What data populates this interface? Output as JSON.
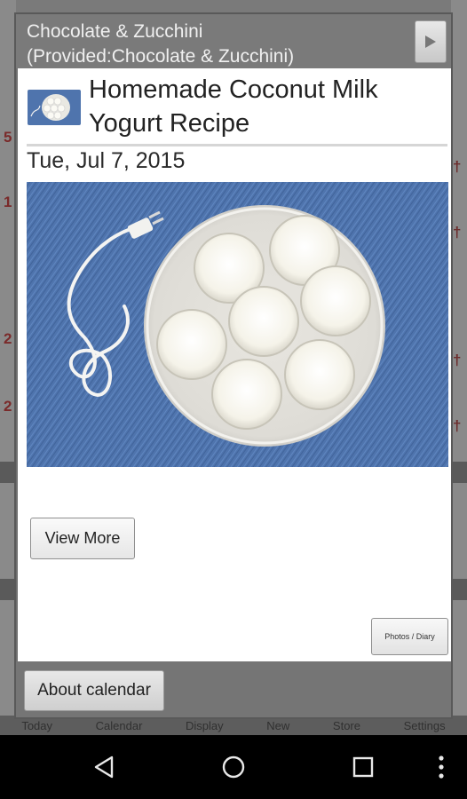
{
  "dialog": {
    "title": "Chocolate & Zucchini\n(Provided:Chocolate & Zucchini)",
    "next_icon": "play-triangle-icon"
  },
  "post": {
    "title": "Homemade Coconut Milk Yogurt Recipe",
    "date": "Tue, Jul 7, 2015",
    "thumbnail_icon": "yogurt-thumbnail",
    "photo_icon": "yogurt-jars-photo"
  },
  "buttons": {
    "view_more": "View More",
    "photos_diary": "Photos / Diary",
    "about_calendar": "About calendar"
  },
  "background_app": {
    "bottom_tabs": [
      "Today",
      "Calendar",
      "Display",
      "New",
      "Store",
      "Settings"
    ]
  },
  "nav": {
    "back_icon": "back-triangle-icon",
    "home_icon": "home-circle-icon",
    "recents_icon": "recents-square-icon",
    "menu_icon": "overflow-menu-icon"
  },
  "colors": {
    "denim_blue": "#4f74ad",
    "dialog_gray": "#757575"
  }
}
